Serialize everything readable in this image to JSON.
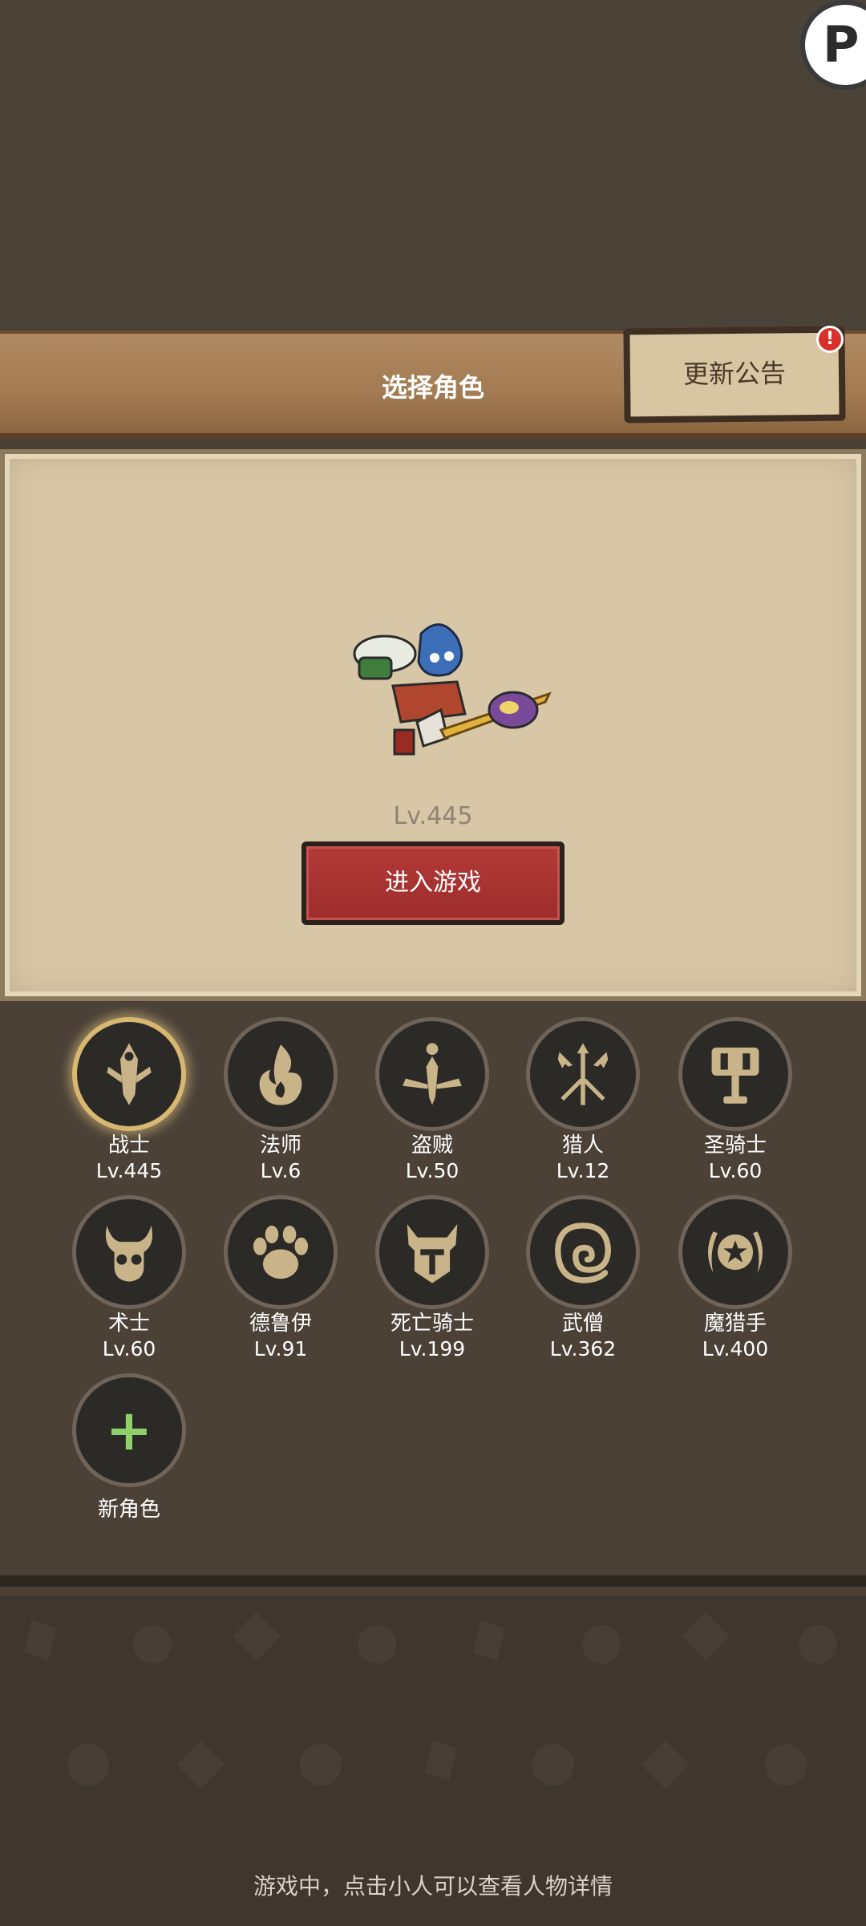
{
  "corner_badge": "P",
  "header": {
    "title": "选择角色",
    "notice_button": "更新公告",
    "notice_alert": "!"
  },
  "selected_character": {
    "level": "Lv.445",
    "enter_button": "进入游戏"
  },
  "classes": [
    {
      "name": "战士",
      "level": "Lv.445",
      "icon": "sword-icon",
      "selected": true
    },
    {
      "name": "法师",
      "level": "Lv.6",
      "icon": "flame-icon"
    },
    {
      "name": "盗贼",
      "level": "Lv.50",
      "icon": "dagger-icon"
    },
    {
      "name": "猎人",
      "level": "Lv.12",
      "icon": "arrows-icon"
    },
    {
      "name": "圣骑士",
      "level": "Lv.60",
      "icon": "hammer-icon"
    },
    {
      "name": "术士",
      "level": "Lv.60",
      "icon": "demon-skull-icon"
    },
    {
      "name": "德鲁伊",
      "level": "Lv.91",
      "icon": "paw-icon"
    },
    {
      "name": "死亡骑士",
      "level": "Lv.199",
      "icon": "helmet-icon"
    },
    {
      "name": "武僧",
      "level": "Lv.362",
      "icon": "swirl-icon"
    },
    {
      "name": "魔猎手",
      "level": "Lv.400",
      "icon": "star-moon-icon"
    }
  ],
  "new_character": {
    "label": "新角色",
    "icon": "plus-icon"
  },
  "footer_hint": "游戏中，点击小人可以查看人物详情",
  "colors": {
    "gold": "#c9b48a",
    "enter_red": "#a3302e",
    "plus_green": "#8fd06b"
  }
}
